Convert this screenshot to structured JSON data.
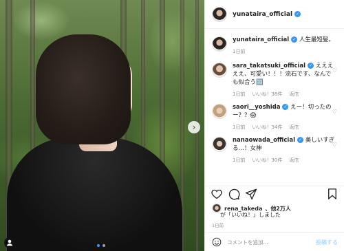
{
  "post": {
    "author": "yunataira_official",
    "caption": "人生最短髪。",
    "caption_time": "1日前"
  },
  "comments": [
    {
      "user": "sara_takatsuki_official",
      "text": "えええええ、可愛い！！！流石です、なんでも似合う🈁",
      "time": "1日前",
      "likes": "いいね！38件",
      "reply": "返信"
    },
    {
      "user": "saori__yoshida",
      "text": "えー！切ったのー？？😱",
      "time": "1日前",
      "likes": "いいね！34件",
      "reply": "返信"
    },
    {
      "user": "nanaowada_official",
      "text": "美しいすぎる…！女神",
      "time": "1日前",
      "likes": "いいね！30件",
      "reply": "返信"
    }
  ],
  "likes": {
    "liker": "rena_takeda",
    "others": "、他2万人",
    "suffix": "が「いいね！」しました"
  },
  "post_date": "1日前",
  "comment_box": {
    "placeholder": "コメントを追加...",
    "post_label": "投稿する"
  },
  "colors": {
    "verified": "#3897f0",
    "post_button": "#b2dffc",
    "muted_text": "#8e8e8e"
  },
  "icons": [
    "heart-icon",
    "comment-icon",
    "share-icon",
    "bookmark-icon",
    "emoji-icon",
    "chevron-right-icon",
    "user-tag-icon",
    "verified-badge-icon"
  ]
}
